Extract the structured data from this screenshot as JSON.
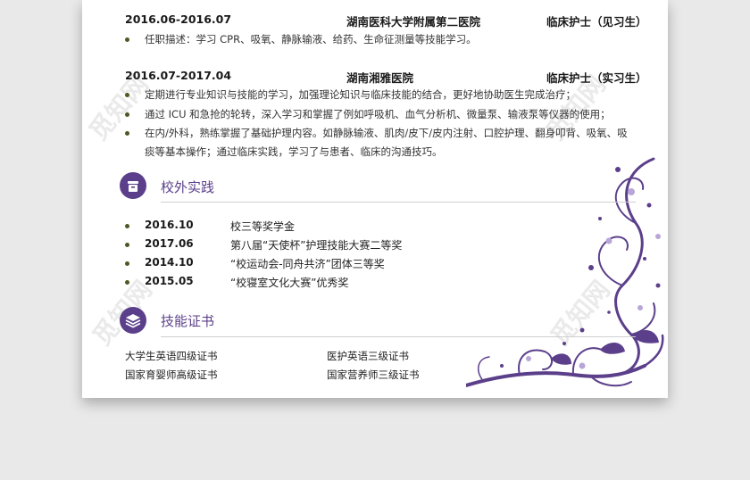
{
  "experience": [
    {
      "date": "2016.06-2016.07",
      "org": "湖南医科大学附属第二医院",
      "role": "临床护士（见习生）",
      "bullets": [
        "任职描述：学习 CPR、吸氧、静脉输液、给药、生命征测量等技能学习。"
      ]
    },
    {
      "date": "2016.07-2017.04",
      "org": "湖南湘雅医院",
      "role": "临床护士（实习生）",
      "bullets": [
        "定期进行专业知识与技能的学习，加强理论知识与临床技能的结合，更好地协助医生完成治疗；",
        "通过 ICU 和急抢的轮转，深入学习和掌握了例如呼吸机、血气分析机、微量泵、输液泵等仪器的使用；",
        "在内/外科，熟练掌握了基础护理内容。如静脉输液、肌肉/皮下/皮内注射、口腔护理、翻身叩背、吸氧、吸",
        "痰等基本操作；通过临床实践，学习了与患者、临床的沟通技巧。"
      ]
    }
  ],
  "practice": {
    "title": "校外实践",
    "items": [
      {
        "date": "2016.10",
        "text": "校三等奖学金"
      },
      {
        "date": "2017.06",
        "text": "第八届“天使杯”护理技能大赛二等奖"
      },
      {
        "date": "2014.10",
        "text": "“校运动会-同舟共济”团体三等奖"
      },
      {
        "date": "2015.05",
        "text": "“校寝室文化大赛”优秀奖"
      }
    ]
  },
  "skills": {
    "title": "技能证书",
    "items": [
      "大学生英语四级证书",
      "医护英语三级证书",
      "国家育婴师高级证书",
      "国家营养师三级证书"
    ]
  },
  "watermark": "觅知网",
  "colors": {
    "accent": "#5b3f8a",
    "bullet": "#4a5a23",
    "background": "#e9e9e9"
  }
}
